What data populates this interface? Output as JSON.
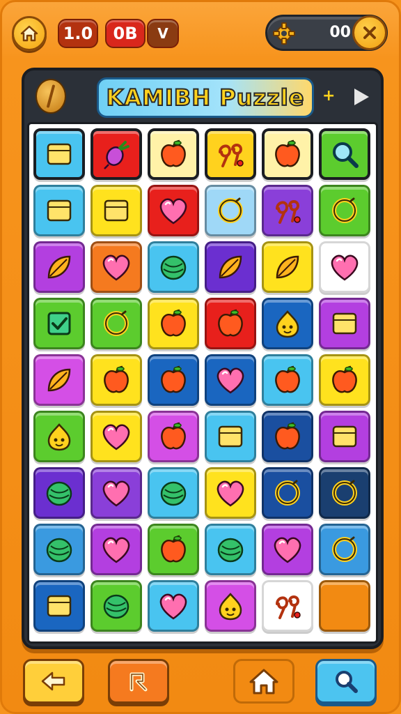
{
  "header": {
    "stat1": "1.0",
    "stat2": "0B",
    "stat3": "V",
    "coins": "00"
  },
  "board": {
    "title": "KAMIBH Puzzle",
    "sparkle": "+"
  },
  "tiles": [
    {
      "bg": "#49c4f0",
      "icon": "square"
    },
    {
      "bg": "#e8201c",
      "icon": "radish"
    },
    {
      "bg": "#fff2a8",
      "icon": "apple"
    },
    {
      "bg": "#ffd21e",
      "icon": "glyph"
    },
    {
      "bg": "#fff2a8",
      "icon": "apple"
    },
    {
      "bg": "#5ccc2e",
      "icon": "magnifier"
    },
    {
      "bg": "#49c4f0",
      "icon": "square"
    },
    {
      "bg": "#ffe21e",
      "icon": "square"
    },
    {
      "bg": "#e8201c",
      "icon": "heart"
    },
    {
      "bg": "#9fd8f7",
      "icon": "ring"
    },
    {
      "bg": "#8a3fd9",
      "icon": "glyph"
    },
    {
      "bg": "#5ccc2e",
      "icon": "ring"
    },
    {
      "bg": "#b33fe0",
      "icon": "leaf"
    },
    {
      "bg": "#f57a1f",
      "icon": "heart"
    },
    {
      "bg": "#49c4f0",
      "icon": "ball"
    },
    {
      "bg": "#6b2fd0",
      "icon": "leaf"
    },
    {
      "bg": "#ffe21e",
      "icon": "leaf"
    },
    {
      "bg": "#ffffff",
      "icon": "heart"
    },
    {
      "bg": "#5ccc2e",
      "icon": "check"
    },
    {
      "bg": "#5ccc2e",
      "icon": "ring"
    },
    {
      "bg": "#ffe21e",
      "icon": "apple"
    },
    {
      "bg": "#e8201c",
      "icon": "apple"
    },
    {
      "bg": "#1a66c0",
      "icon": "face"
    },
    {
      "bg": "#b33fe0",
      "icon": "square"
    },
    {
      "bg": "#d44fe6",
      "icon": "leaf"
    },
    {
      "bg": "#ffe21e",
      "icon": "apple"
    },
    {
      "bg": "#1a66c0",
      "icon": "apple"
    },
    {
      "bg": "#1a66c0",
      "icon": "heart"
    },
    {
      "bg": "#49c4f0",
      "icon": "apple"
    },
    {
      "bg": "#ffe21e",
      "icon": "apple"
    },
    {
      "bg": "#5ccc2e",
      "icon": "face"
    },
    {
      "bg": "#ffe21e",
      "icon": "heart"
    },
    {
      "bg": "#d44fe6",
      "icon": "apple"
    },
    {
      "bg": "#49c4f0",
      "icon": "square"
    },
    {
      "bg": "#1a4fa0",
      "icon": "apple"
    },
    {
      "bg": "#b33fe0",
      "icon": "square"
    },
    {
      "bg": "#6b2fd0",
      "icon": "ball"
    },
    {
      "bg": "#8a3fd9",
      "icon": "heart"
    },
    {
      "bg": "#49c4f0",
      "icon": "ball"
    },
    {
      "bg": "#ffe21e",
      "icon": "heart"
    },
    {
      "bg": "#1a4fa0",
      "icon": "ring"
    },
    {
      "bg": "#1a3f70",
      "icon": "ring"
    },
    {
      "bg": "#3a9ae0",
      "icon": "ball"
    },
    {
      "bg": "#b33fe0",
      "icon": "heart"
    },
    {
      "bg": "#5ccc2e",
      "icon": "apple"
    },
    {
      "bg": "#49c4f0",
      "icon": "ball"
    },
    {
      "bg": "#b33fe0",
      "icon": "heart"
    },
    {
      "bg": "#3a9ae0",
      "icon": "ring"
    },
    {
      "bg": "#1a66c0",
      "icon": "square"
    },
    {
      "bg": "#5ccc2e",
      "icon": "ball"
    },
    {
      "bg": "#49c4f0",
      "icon": "heart"
    },
    {
      "bg": "#d44fe6",
      "icon": "face"
    },
    {
      "bg": "#ffffff",
      "icon": "glyph"
    },
    {
      "bg": "#f28a12",
      "icon": "none"
    }
  ],
  "selected_tiles": [
    0,
    1,
    2,
    3,
    4,
    5
  ]
}
